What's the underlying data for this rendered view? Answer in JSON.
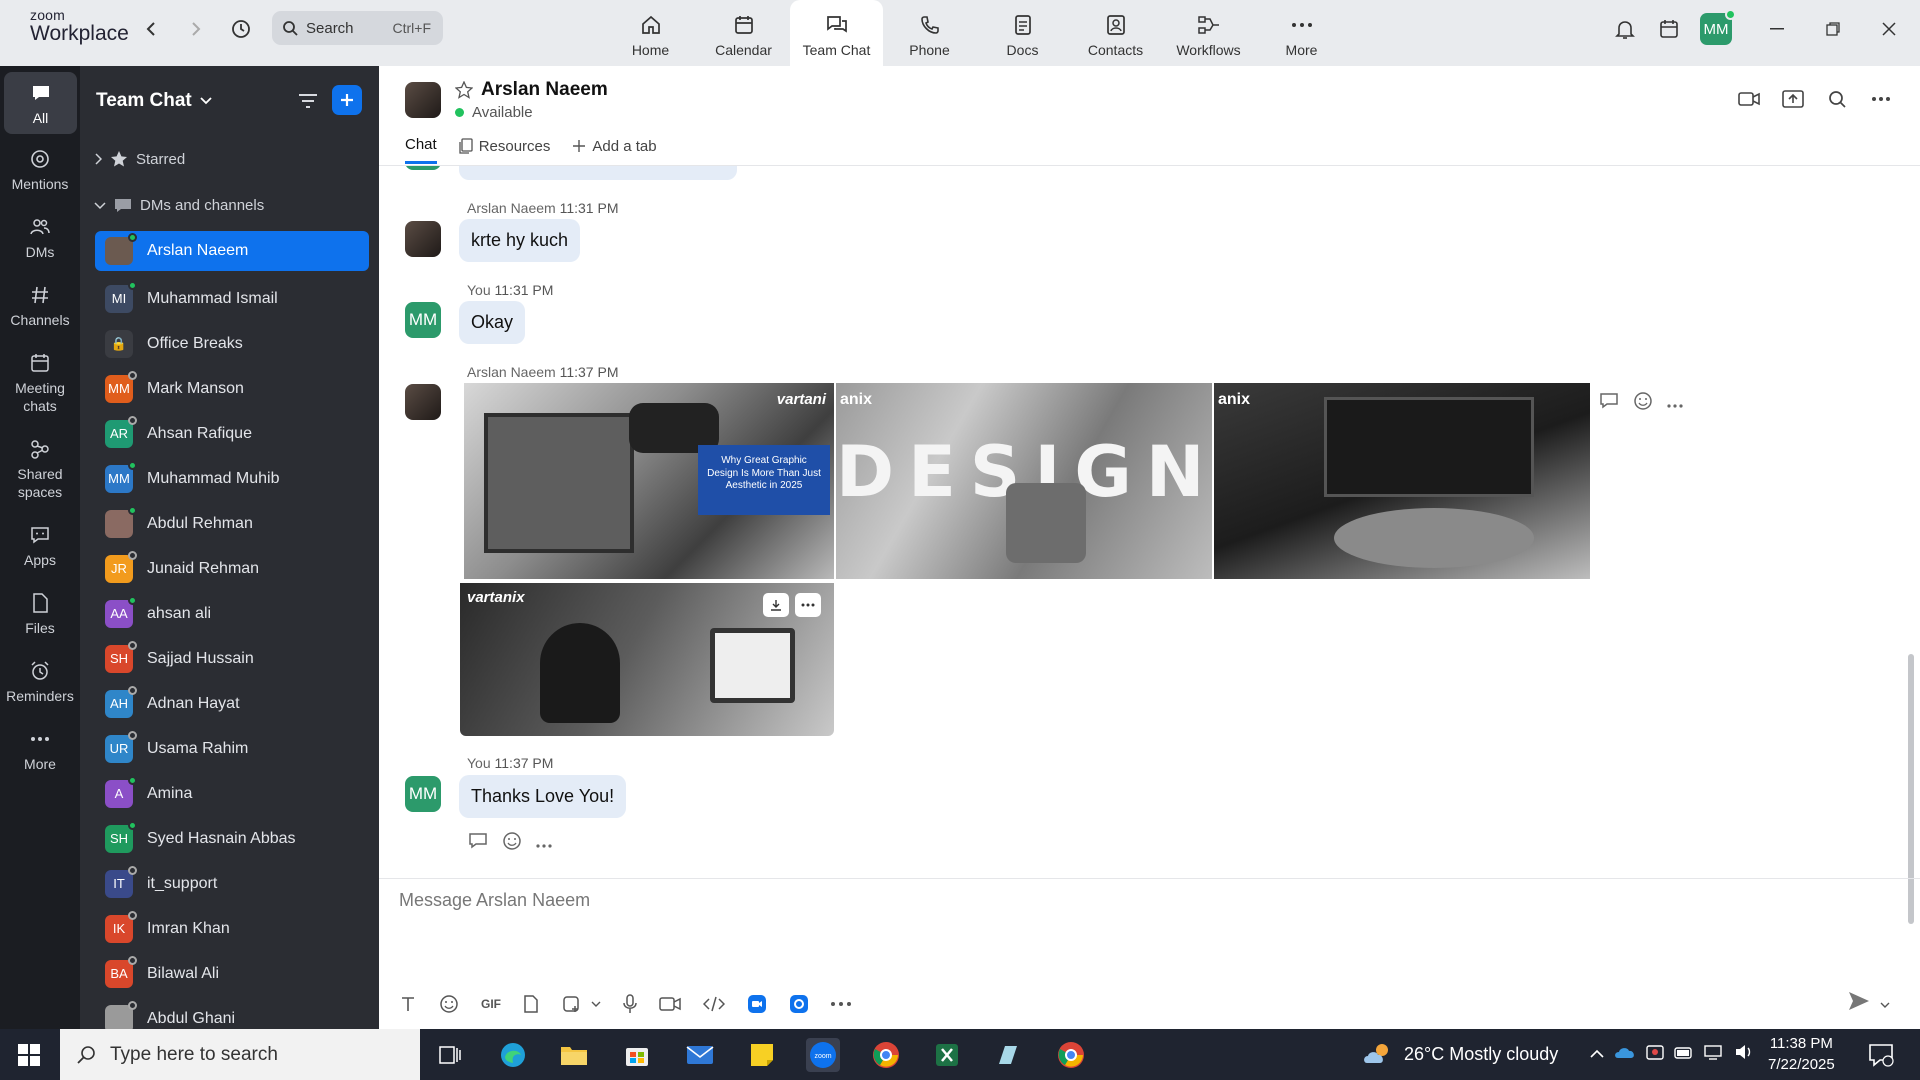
{
  "app": {
    "brand_top": "zoom",
    "brand_bottom": "Workplace"
  },
  "search": {
    "label": "Search",
    "shortcut": "Ctrl+F"
  },
  "nav": [
    {
      "label": "Home",
      "icon": "home-icon"
    },
    {
      "label": "Calendar",
      "icon": "calendar-icon"
    },
    {
      "label": "Team Chat",
      "icon": "chat-icon",
      "active": true
    },
    {
      "label": "Phone",
      "icon": "phone-icon"
    },
    {
      "label": "Docs",
      "icon": "docs-icon"
    },
    {
      "label": "Contacts",
      "icon": "contacts-icon"
    },
    {
      "label": "Workflows",
      "icon": "workflows-icon"
    },
    {
      "label": "More",
      "icon": "more-icon"
    }
  ],
  "user": {
    "initials": "MM",
    "color": "#2c9a6b"
  },
  "rail": [
    {
      "label": "All",
      "icon": "chat-bubble-icon",
      "active": true
    },
    {
      "label": "Mentions",
      "icon": "at-icon"
    },
    {
      "label": "DMs",
      "icon": "people-icon"
    },
    {
      "label": "Channels",
      "icon": "hash-icon"
    },
    {
      "label": "Meeting chats",
      "icon": "calendar-icon"
    },
    {
      "label": "Shared spaces",
      "icon": "shared-icon"
    },
    {
      "label": "Apps",
      "icon": "apps-icon"
    },
    {
      "label": "Files",
      "icon": "file-icon"
    },
    {
      "label": "Reminders",
      "icon": "alarm-icon"
    },
    {
      "label": "More",
      "icon": "more-icon"
    }
  ],
  "sidebar": {
    "title": "Team Chat",
    "starred": "Starred",
    "dms_channels": "DMs and channels",
    "items": [
      {
        "name": "Arslan Naeem",
        "initials": "",
        "color": "#6b5a50",
        "status": "on",
        "active": true
      },
      {
        "name": "Muhammad Ismail",
        "initials": "MI",
        "color": "#3d4a63",
        "status": "on"
      },
      {
        "name": "Office Breaks",
        "initials": "🔒",
        "color": "#3a3c42",
        "status": ""
      },
      {
        "name": "Mark Manson",
        "initials": "MM",
        "color": "#e05d1c",
        "status": "off"
      },
      {
        "name": "Ahsan Rafique",
        "initials": "AR",
        "color": "#1f9a73",
        "status": "off"
      },
      {
        "name": "Muhammad Muhib",
        "initials": "MM",
        "color": "#2c78c7",
        "status": "on"
      },
      {
        "name": "Abdul Rehman",
        "initials": "",
        "color": "#8a6a62",
        "status": "on"
      },
      {
        "name": "Junaid Rehman",
        "initials": "JR",
        "color": "#f29b1d",
        "status": "off"
      },
      {
        "name": "ahsan ali",
        "initials": "AA",
        "color": "#8b4fc7",
        "status": "on"
      },
      {
        "name": "Sajjad Hussain",
        "initials": "SH",
        "color": "#d9472b",
        "status": "off"
      },
      {
        "name": "Adnan Hayat",
        "initials": "AH",
        "color": "#2f86c9",
        "status": "off"
      },
      {
        "name": "Usama Rahim",
        "initials": "UR",
        "color": "#2f86c9",
        "status": "off"
      },
      {
        "name": "Amina",
        "initials": "A",
        "color": "#8b4fc7",
        "status": "on"
      },
      {
        "name": "Syed Hasnain Abbas",
        "initials": "SH",
        "color": "#1f9a5e",
        "status": "on"
      },
      {
        "name": "it_support",
        "initials": "IT",
        "color": "#3a4a8a",
        "status": "off"
      },
      {
        "name": "Imran Khan",
        "initials": "IK",
        "color": "#d9472b",
        "status": "off"
      },
      {
        "name": "Bilawal Ali",
        "initials": "BA",
        "color": "#d9472b",
        "status": "off"
      },
      {
        "name": "Abdul Ghani",
        "initials": "",
        "color": "#9a9a9a",
        "status": "off"
      }
    ]
  },
  "chat": {
    "name": "Arslan Naeem",
    "status": "Available",
    "tabs": {
      "chat": "Chat",
      "resources": "Resources",
      "add": "Add a tab"
    },
    "messages": [
      {
        "sender": "Arslan Naeem",
        "time": "11:31 PM",
        "text": "krte hy kuch"
      },
      {
        "sender": "You",
        "time": "11:31 PM",
        "text": "Okay"
      },
      {
        "sender": "Arslan Naeem",
        "time": "11:37 PM",
        "text": ""
      },
      {
        "sender": "You",
        "time": "11:37 PM",
        "text": "Thanks Love You!"
      }
    ],
    "images": {
      "img1_brand": "vartani",
      "img1_caption": "Why Great Graphic Design Is More Than Just Aesthetic in 2025",
      "img2_brand": "anix",
      "img2_word": "DESIGN",
      "img3_brand": "anix",
      "img4_brand": "vartanix"
    },
    "composer_placeholder": "Message Arslan Naeem"
  },
  "taskbar": {
    "search_placeholder": "Type here to search",
    "weather": "26°C  Mostly cloudy",
    "time": "11:38 PM",
    "date": "7/22/2025"
  }
}
